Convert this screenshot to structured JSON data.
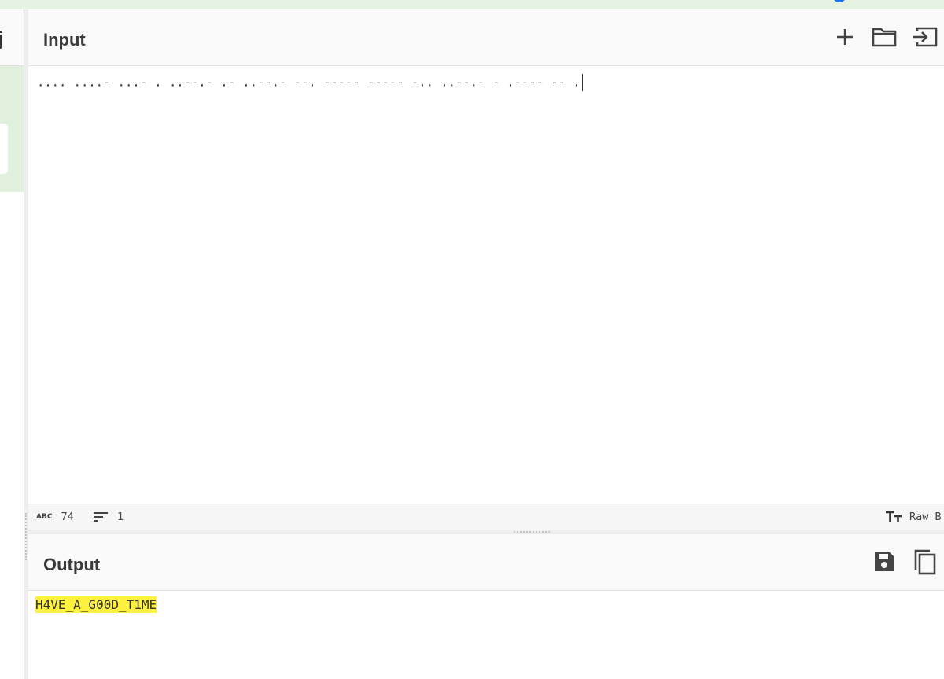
{
  "colors": {
    "accent_green": "#e2f1dd",
    "gear_blue": "#1a73e8",
    "highlight_yellow": "#fff23f"
  },
  "input": {
    "title": "Input",
    "value": ".... ....- ...- . ..--.- .- ..--.- --. ----- ----- -.. ..--.- - .---- -- .",
    "buttons": {
      "new": "plus-icon",
      "open": "folder-icon",
      "load": "input-arrow-icon"
    }
  },
  "status": {
    "char_label": "ABC",
    "char_count": "74",
    "line_count": "1",
    "format_label": "Raw B"
  },
  "output": {
    "title": "Output",
    "value": "H4VE_A_G00D_T1ME"
  }
}
